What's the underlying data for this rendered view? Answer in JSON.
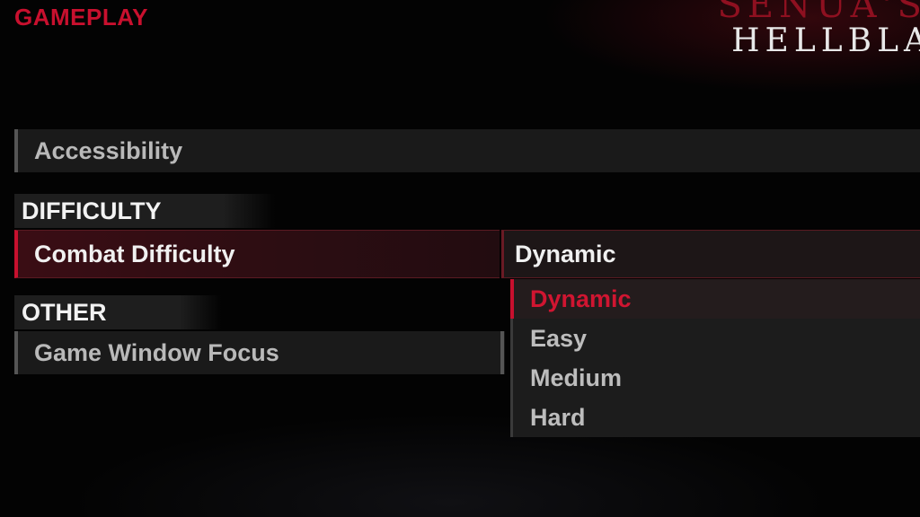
{
  "screen": {
    "title": "GAMEPLAY"
  },
  "logo": {
    "line1": "SENUA'S S",
    "line2": "HELLBLA"
  },
  "rows": {
    "accessibility": {
      "label": "Accessibility"
    },
    "combat_difficulty": {
      "label": "Combat Difficulty",
      "value": "Dynamic"
    },
    "game_window_focus": {
      "label": "Game Window Focus"
    }
  },
  "sections": {
    "difficulty": "DIFFICULTY",
    "other": "OTHER"
  },
  "dropdown": {
    "selected": "Dynamic",
    "options": [
      "Dynamic",
      "Easy",
      "Medium",
      "Hard"
    ]
  },
  "colors": {
    "accent": "#c8102e",
    "text": "#f0f0f0",
    "muted_text": "#b9b9b9",
    "panel": "#1a1a1a"
  }
}
